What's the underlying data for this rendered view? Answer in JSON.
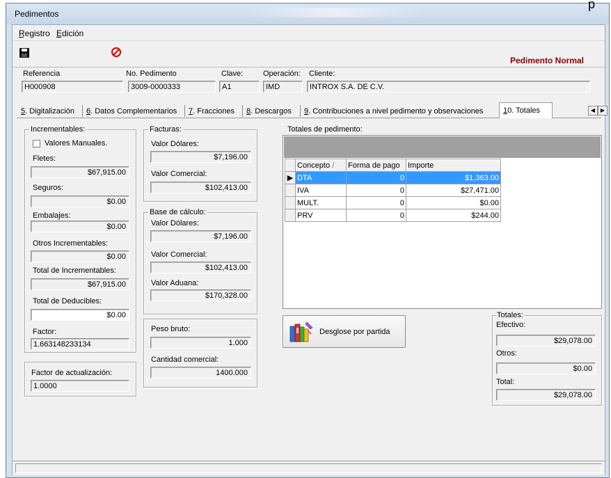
{
  "window": {
    "title": "Pedimentos",
    "corner_glyph": "p"
  },
  "menu": {
    "registro": "Registro",
    "edicion": "Edición"
  },
  "toolbar": {
    "save_icon": "save-icon",
    "cancel_icon": "cancel-icon",
    "mode_label": "Pedimento Normal"
  },
  "header": {
    "referencia_label": "Referencia",
    "referencia_value": "H000908",
    "no_pedimento_label": "No. Pedimento",
    "no_pedimento_value": "3009-0000333",
    "clave_label": "Clave:",
    "clave_value": "A1",
    "operacion_label": "Operación:",
    "operacion_value": "IMD",
    "cliente_label": "Cliente:",
    "cliente_value": "INTROX S.A. DE C.V."
  },
  "tabs": [
    {
      "key": "5",
      "label": ". Digitalización"
    },
    {
      "key": "6",
      "label": ". Datos Complementarios"
    },
    {
      "key": "7",
      "label": ". Fracciones"
    },
    {
      "key": "8",
      "label": ". Descargos"
    },
    {
      "key": "9",
      "label": ". Contribuciones a nivel pedimento y observaciones"
    },
    {
      "key": "1",
      "label": "0. Totales"
    }
  ],
  "incrementables": {
    "title": "Incrementables:",
    "valores_manuales": "Valores Manuales.",
    "fletes_label": "Fletes:",
    "fletes_value": "$67,915.00",
    "seguros_label": "Seguros:",
    "seguros_value": "$0.00",
    "embalajes_label": "Embalajes:",
    "embalajes_value": "$0.00",
    "otros_label": "Otros Incrementables:",
    "otros_value": "$0.00",
    "total_inc_label": "Total de Incrementables:",
    "total_inc_value": "$67,915.00",
    "total_ded_label": "Total de Deducibles:",
    "total_ded_value": "$0.00",
    "factor_label": "Factor:",
    "factor_value": "1.663148233134"
  },
  "factor_actualizacion": {
    "label": "Factor de actualización:",
    "value": "1.0000"
  },
  "facturas": {
    "title": "Facturas:",
    "valor_dolares_label": "Valor Dólares:",
    "valor_dolares_value": "$7,196.00",
    "valor_comercial_label": "Valor Comercial:",
    "valor_comercial_value": "$102,413.00"
  },
  "base_calculo": {
    "title": "Base de cálculo:",
    "valor_dolares_label": "Valor Dólares:",
    "valor_dolares_value": "$7,196.00",
    "valor_comercial_label": "Valor Comercial:",
    "valor_comercial_value": "$102,413.00",
    "valor_aduana_label": "Valor Aduana:",
    "valor_aduana_value": "$170,328.00"
  },
  "peso": {
    "peso_bruto_label": "Peso bruto:",
    "peso_bruto_value": "1.000",
    "cantidad_label": "Cantidad comercial:",
    "cantidad_value": "1400.000"
  },
  "totales_pedimento": {
    "title": "Totales de pedimento:",
    "columns": {
      "concepto": "Concepto",
      "sort_glyph": "/",
      "forma": "Forma de pago",
      "importe": "Importe"
    },
    "rows": [
      {
        "concepto": "DTA",
        "forma": "0",
        "importe": "$1,363.00"
      },
      {
        "concepto": "IVA",
        "forma": "0",
        "importe": "$27,471.00"
      },
      {
        "concepto": "MULT.",
        "forma": "0",
        "importe": "$0.00"
      },
      {
        "concepto": "PRV",
        "forma": "0",
        "importe": "$244.00"
      }
    ],
    "current_row_glyph": "▶"
  },
  "desglose_button": {
    "label": "Desglose por partida",
    "icon": "books-icon"
  },
  "totales": {
    "title": "Totales:",
    "efectivo_label": "Efectivo:",
    "efectivo_value": "$29,078.00",
    "otros_label": "Otros:",
    "otros_value": "$0.00",
    "total_label": "Total:",
    "total_value": "$29,078.00"
  },
  "colors": {
    "mode_label": "#8b0000",
    "selection": "#3399ff",
    "cancel": "#e00000"
  }
}
